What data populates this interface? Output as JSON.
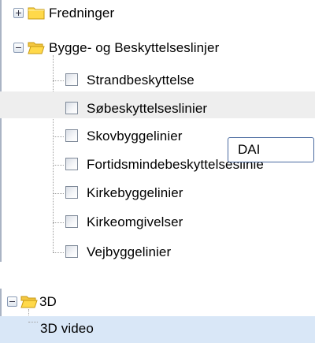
{
  "tree1": {
    "fredninger": {
      "label": "Fredninger"
    },
    "bygge": {
      "label": "Bygge- og Beskyttelseslinjer",
      "children": [
        "Strandbeskyttelse",
        "Søbeskyttelseslinier",
        "Skovbyggelinier",
        "Fortidsmindebeskyttelseslinie",
        "Kirkebyggelinier",
        "Kirkeomgivelser",
        "Vejbyggelinier"
      ]
    }
  },
  "tooltip": {
    "text": "DAI"
  },
  "tree2": {
    "folder": {
      "label": "3D"
    },
    "item": {
      "label": "3D video"
    }
  },
  "colors": {
    "folder_fill": "#ffd94a",
    "folder_stroke": "#c79a12",
    "selected_row": "#d9e7f7",
    "hover_row": "#eeeeee"
  }
}
